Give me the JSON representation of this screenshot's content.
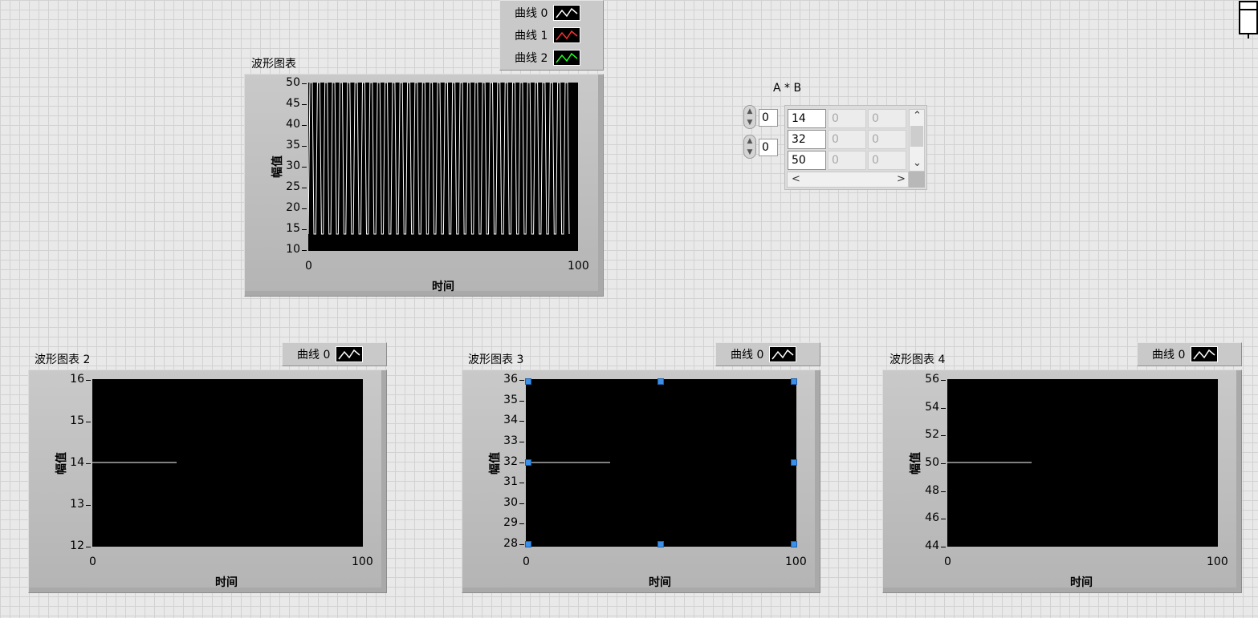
{
  "chart1": {
    "caption": "波形图表",
    "ylabel": "幅值",
    "xlabel": "时间",
    "yticks": [
      "50",
      "45",
      "40",
      "35",
      "30",
      "25",
      "20",
      "15",
      "10"
    ],
    "xticks": [
      "0",
      "100"
    ],
    "legend": [
      {
        "label": "曲线 0",
        "color": "#ffffff"
      },
      {
        "label": "曲线 1",
        "color": "#ff3030"
      },
      {
        "label": "曲线 2",
        "color": "#20ff20"
      }
    ]
  },
  "chart2": {
    "caption": "波形图表 2",
    "ylabel": "幅值",
    "xlabel": "时间",
    "yticks": [
      "16",
      "15",
      "14",
      "13",
      "12"
    ],
    "xticks": [
      "0",
      "100"
    ],
    "legend_label": "曲线 0"
  },
  "chart3": {
    "caption": "波形图表 3",
    "ylabel": "幅值",
    "xlabel": "时间",
    "yticks": [
      "36",
      "35",
      "34",
      "33",
      "32",
      "31",
      "30",
      "29",
      "28"
    ],
    "xticks": [
      "0",
      "100"
    ],
    "legend_label": "曲线 0"
  },
  "chart4": {
    "caption": "波形图表 4",
    "ylabel": "幅值",
    "xlabel": "时间",
    "yticks": [
      "56",
      "54",
      "52",
      "50",
      "48",
      "46",
      "44"
    ],
    "xticks": [
      "0",
      "100"
    ],
    "legend_label": "曲线 0"
  },
  "array": {
    "caption": "A * B",
    "index_row": "0",
    "index_col": "0",
    "rows": [
      [
        "14",
        "0",
        "0"
      ],
      [
        "32",
        "0",
        "0"
      ],
      [
        "50",
        "0",
        "0"
      ]
    ]
  },
  "chart_data": [
    {
      "type": "line",
      "title": "波形图表",
      "xlabel": "时间",
      "ylabel": "幅值",
      "xlim": [
        0,
        100
      ],
      "ylim": [
        10,
        50
      ],
      "series": [
        {
          "name": "曲线 0",
          "pattern": "rapid oscillation between 14 and 50"
        }
      ]
    },
    {
      "type": "line",
      "title": "波形图表 2",
      "xlabel": "时间",
      "ylabel": "幅值",
      "xlim": [
        0,
        100
      ],
      "ylim": [
        12,
        16
      ],
      "series": [
        {
          "name": "曲线 0",
          "x": [
            0,
            31
          ],
          "y": [
            14,
            14
          ]
        }
      ]
    },
    {
      "type": "line",
      "title": "波形图表 3",
      "xlabel": "时间",
      "ylabel": "幅值",
      "xlim": [
        0,
        100
      ],
      "ylim": [
        28,
        36
      ],
      "series": [
        {
          "name": "曲线 0",
          "x": [
            0,
            31
          ],
          "y": [
            32,
            32
          ]
        }
      ]
    },
    {
      "type": "line",
      "title": "波形图表 4",
      "xlabel": "时间",
      "ylabel": "幅值",
      "xlim": [
        0,
        100
      ],
      "ylim": [
        44,
        56
      ],
      "series": [
        {
          "name": "曲线 0",
          "x": [
            0,
            31
          ],
          "y": [
            50,
            50
          ]
        }
      ]
    }
  ]
}
